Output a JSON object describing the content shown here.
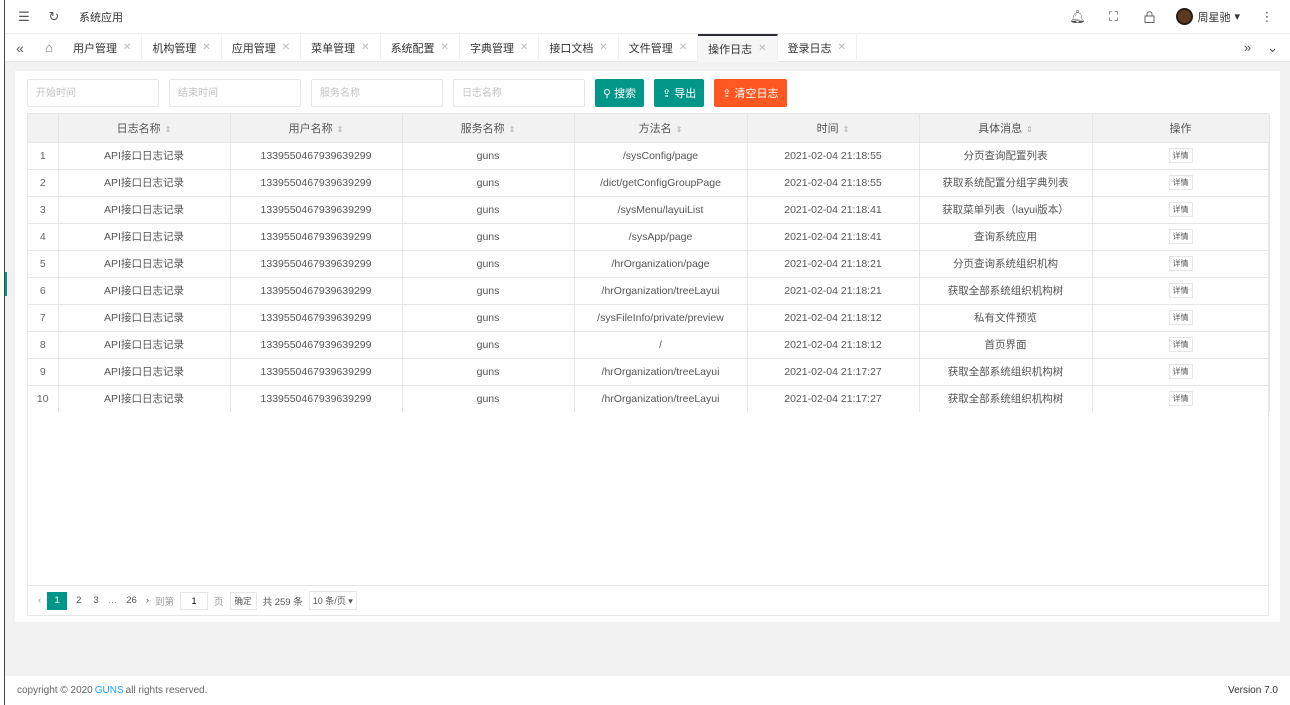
{
  "header": {
    "app_title": "系统应用",
    "user_name": "周星驰"
  },
  "tabs": [
    {
      "label": "用户管理"
    },
    {
      "label": "机构管理"
    },
    {
      "label": "应用管理"
    },
    {
      "label": "菜单管理"
    },
    {
      "label": "系统配置"
    },
    {
      "label": "字典管理"
    },
    {
      "label": "接口文档"
    },
    {
      "label": "文件管理"
    },
    {
      "label": "操作日志",
      "active": true
    },
    {
      "label": "登录日志"
    }
  ],
  "search": {
    "start_time_placeholder": "开始时间",
    "end_time_placeholder": "结束时间",
    "service_placeholder": "服务名称",
    "log_name_placeholder": "日志名称",
    "search_label": "搜索",
    "export_label": "导出",
    "clear_label": "清空日志"
  },
  "table": {
    "columns": [
      "",
      "日志名称",
      "用户名称",
      "服务名称",
      "方法名",
      "时间",
      "具体消息",
      "操作"
    ],
    "detail_label": "详情",
    "rows": [
      {
        "idx": "1",
        "log": "API接口日志记录",
        "user": "1339550467939639299",
        "service": "guns",
        "method": "/sysConfig/page",
        "time": "2021-02-04 21:18:55",
        "message": "分页查询配置列表"
      },
      {
        "idx": "2",
        "log": "API接口日志记录",
        "user": "1339550467939639299",
        "service": "guns",
        "method": "/dict/getConfigGroupPage",
        "time": "2021-02-04 21:18:55",
        "message": "获取系统配置分组字典列表"
      },
      {
        "idx": "3",
        "log": "API接口日志记录",
        "user": "1339550467939639299",
        "service": "guns",
        "method": "/sysMenu/layuiList",
        "time": "2021-02-04 21:18:41",
        "message": "获取菜单列表（layui版本）"
      },
      {
        "idx": "4",
        "log": "API接口日志记录",
        "user": "1339550467939639299",
        "service": "guns",
        "method": "/sysApp/page",
        "time": "2021-02-04 21:18:41",
        "message": "查询系统应用"
      },
      {
        "idx": "5",
        "log": "API接口日志记录",
        "user": "1339550467939639299",
        "service": "guns",
        "method": "/hrOrganization/page",
        "time": "2021-02-04 21:18:21",
        "message": "分页查询系统组织机构"
      },
      {
        "idx": "6",
        "log": "API接口日志记录",
        "user": "1339550467939639299",
        "service": "guns",
        "method": "/hrOrganization/treeLayui",
        "time": "2021-02-04 21:18:21",
        "message": "获取全部系统组织机构树"
      },
      {
        "idx": "7",
        "log": "API接口日志记录",
        "user": "1339550467939639299",
        "service": "guns",
        "method": "/sysFileInfo/private/preview",
        "time": "2021-02-04 21:18:12",
        "message": "私有文件预览"
      },
      {
        "idx": "8",
        "log": "API接口日志记录",
        "user": "1339550467939639299",
        "service": "guns",
        "method": "/",
        "time": "2021-02-04 21:18:12",
        "message": "首页界面"
      },
      {
        "idx": "9",
        "log": "API接口日志记录",
        "user": "1339550467939639299",
        "service": "guns",
        "method": "/hrOrganization/treeLayui",
        "time": "2021-02-04 21:17:27",
        "message": "获取全部系统组织机构树"
      },
      {
        "idx": "10",
        "log": "API接口日志记录",
        "user": "1339550467939639299",
        "service": "guns",
        "method": "/hrOrganization/treeLayui",
        "time": "2021-02-04 21:17:27",
        "message": "获取全部系统组织机构树"
      }
    ]
  },
  "pagination": {
    "current": "1",
    "page2": "2",
    "page3": "3",
    "ellipsis": "…",
    "last": "26",
    "goto_label": "到第",
    "goto_value": "1",
    "page_unit": "页",
    "confirm_label": "确定",
    "total_label": "共 259 条",
    "page_size": "10 条/页"
  },
  "footer": {
    "copyright_prefix": "copyright © 2020",
    "brand": "GUNS",
    "copyright_suffix": "all rights reserved.",
    "version": "Version 7.0"
  }
}
